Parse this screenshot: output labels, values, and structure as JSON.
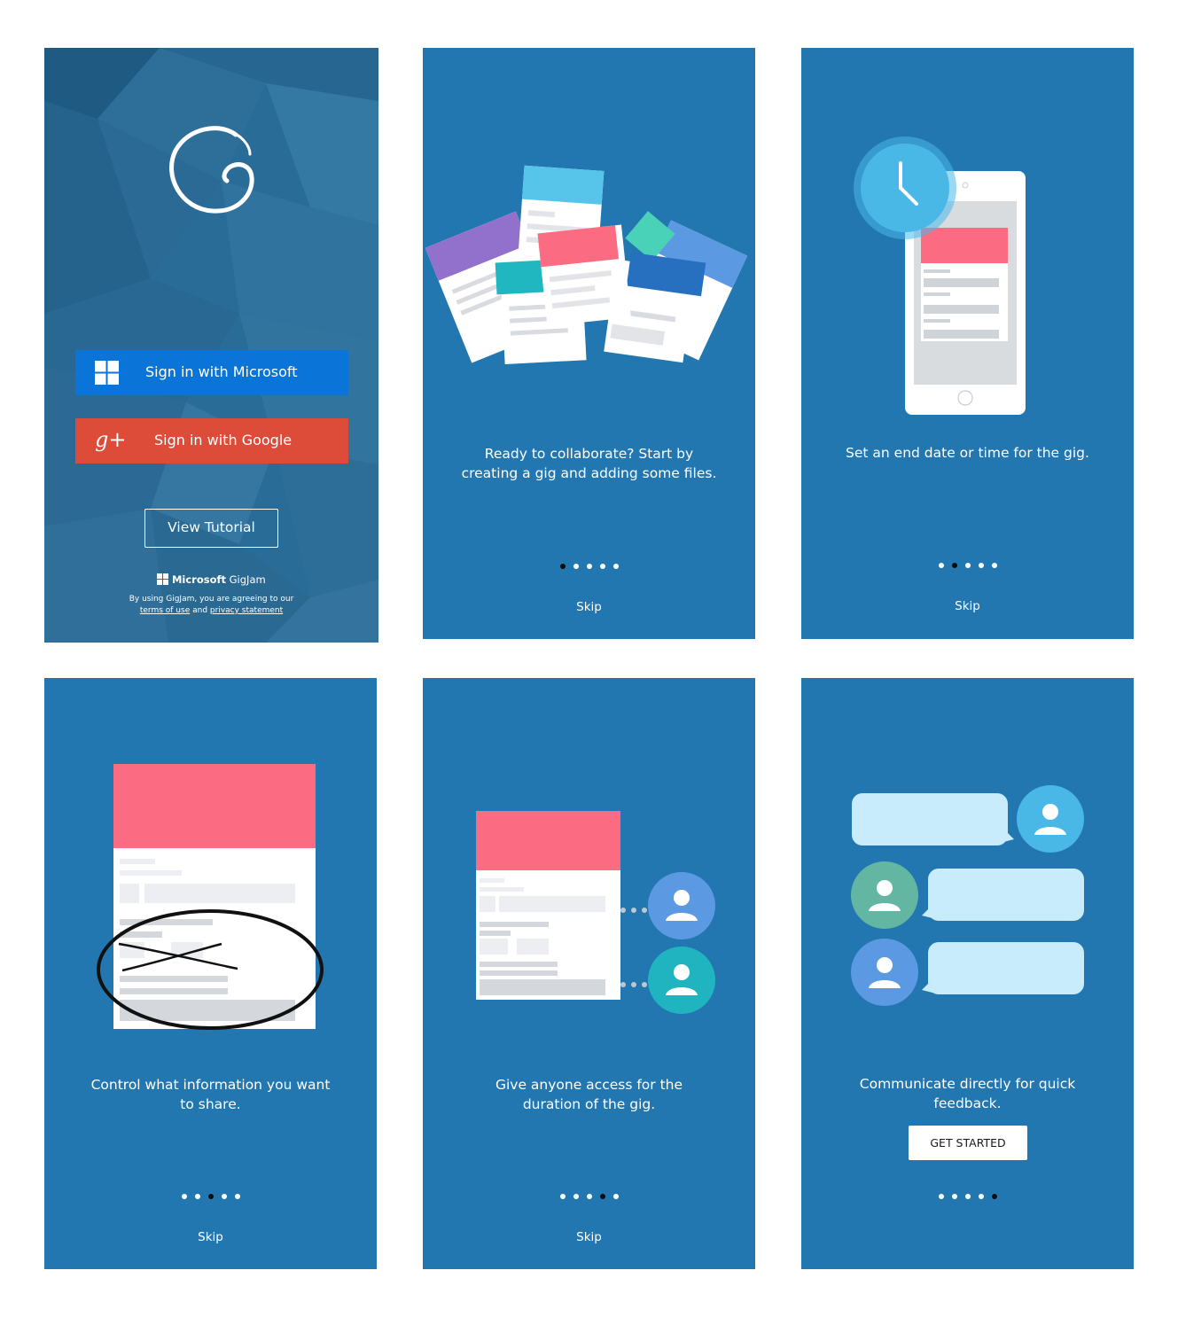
{
  "colors": {
    "screen_blue": "#2377b0",
    "login_bg": "#2a6c98",
    "microsoft_blue": "#0b74d8",
    "google_red": "#dd4b39",
    "accent_pink": "#fb6b81",
    "bubble_light": "#c9ecfc"
  },
  "login": {
    "logo_icon": "gigjam-g-logo",
    "microsoft_label": "Sign in with Microsoft",
    "google_label": "Sign in with Google",
    "tutorial_label": "View Tutorial",
    "brand_microsoft": "Microsoft",
    "brand_product": "GigJam",
    "legal_prefix": "By using GigJam, you are agreeing to our",
    "terms_link": "terms of use",
    "legal_and": "and",
    "privacy_link": "privacy statement"
  },
  "tutorial": [
    {
      "caption_line1": "Ready to collaborate? Start by",
      "caption_line2": "creating a gig and adding some files.",
      "active_dot": 1,
      "skip": "Skip"
    },
    {
      "caption_line1": "Set an end date or time for the gig.",
      "caption_line2": "",
      "active_dot": 2,
      "skip": "Skip"
    },
    {
      "caption_line1": "Control what information you want",
      "caption_line2": "to share.",
      "active_dot": 3,
      "skip": "Skip"
    },
    {
      "caption_line1": "Give anyone access for the",
      "caption_line2": "duration of the gig.",
      "active_dot": 4,
      "skip": "Skip"
    },
    {
      "caption_line1": "Communicate directly for quick",
      "caption_line2": "feedback.",
      "active_dot": 5,
      "get_started": "GET STARTED"
    }
  ]
}
